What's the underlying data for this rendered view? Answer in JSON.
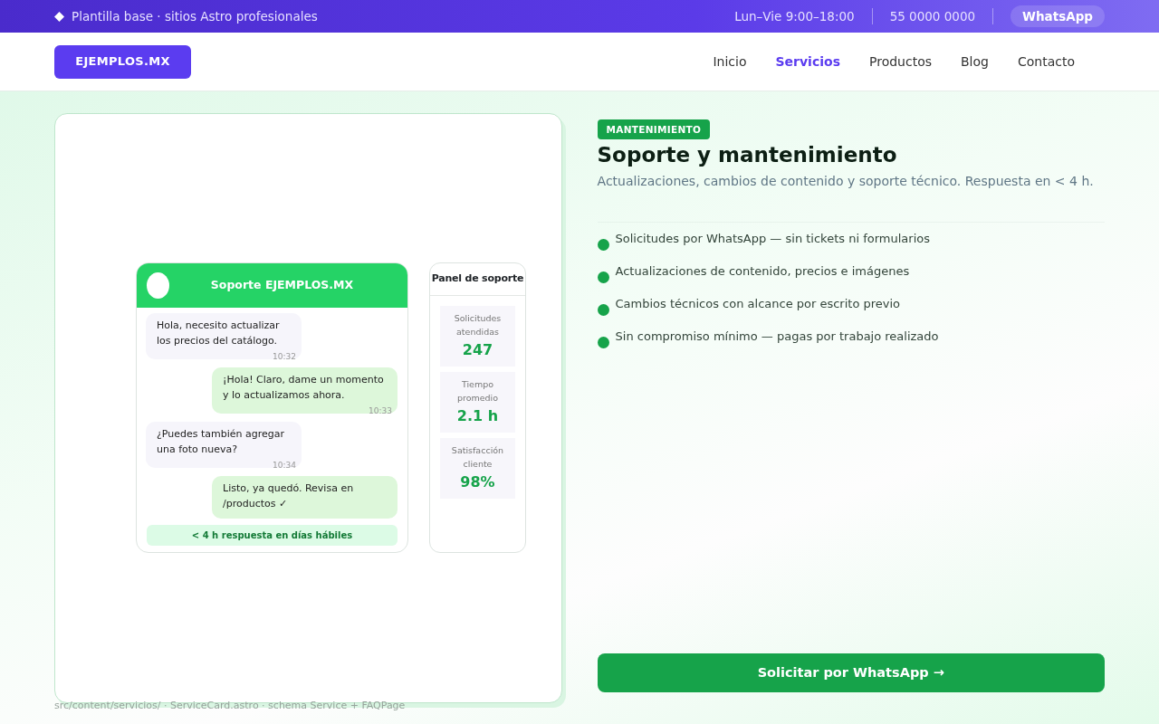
{
  "topbar": {
    "tagline": "Plantilla base · sitios Astro profesionales",
    "hours": "Lun–Vie  9:00–18:00",
    "phone": "55 0000 0000",
    "whatsapp": "WhatsApp"
  },
  "navbar": {
    "brand": "EJEMPLOS.MX",
    "items": [
      {
        "label": "Inicio",
        "selected": false
      },
      {
        "label": "Servicios",
        "selected": true
      },
      {
        "label": "Productos",
        "selected": false
      },
      {
        "label": "Blog",
        "selected": false
      },
      {
        "label": "Contacto",
        "selected": false
      }
    ]
  },
  "chat": {
    "title": "Soporte EJEMPLOS.MX",
    "messages": [
      {
        "kind": "received",
        "text": "Hola, necesito actualizar los precios del catálogo.",
        "time": "10:32"
      },
      {
        "kind": "sent",
        "text": "¡Hola! Claro, dame un momento y lo actualizamos ahora.",
        "time": "10:33"
      },
      {
        "kind": "received",
        "text": "¿Puedes también agregar una foto nueva?",
        "time": "10:34"
      },
      {
        "kind": "sent",
        "text": "Listo, ya quedó. Revisa en /productos ✓"
      }
    ],
    "footer": "< 4 h respuesta en días hábiles"
  },
  "panel": {
    "title": "Panel de soporte",
    "stats": [
      {
        "label": "Solicitudes atendidas",
        "value": "247"
      },
      {
        "label": "Tiempo promedio",
        "value": "2.1 h"
      },
      {
        "label": "Satisfacción cliente",
        "value": "98%"
      }
    ]
  },
  "service": {
    "tag": "MANTENIMIENTO",
    "title": "Soporte y mantenimiento",
    "description": "Actualizaciones, cambios de contenido y soporte técnico. Respuesta en < 4 h.",
    "features": [
      "Solicitudes por WhatsApp — sin tickets ni formularios",
      "Actualizaciones de contenido, precios e imágenes",
      "Cambios técnicos con alcance por escrito previo",
      "Sin compromiso mínimo — pagas por trabajo realizado"
    ],
    "cta": "Solicitar por WhatsApp →"
  },
  "source_note": "src/content/servicios/ · ServiceCard.astro · schema Service + FAQPage"
}
